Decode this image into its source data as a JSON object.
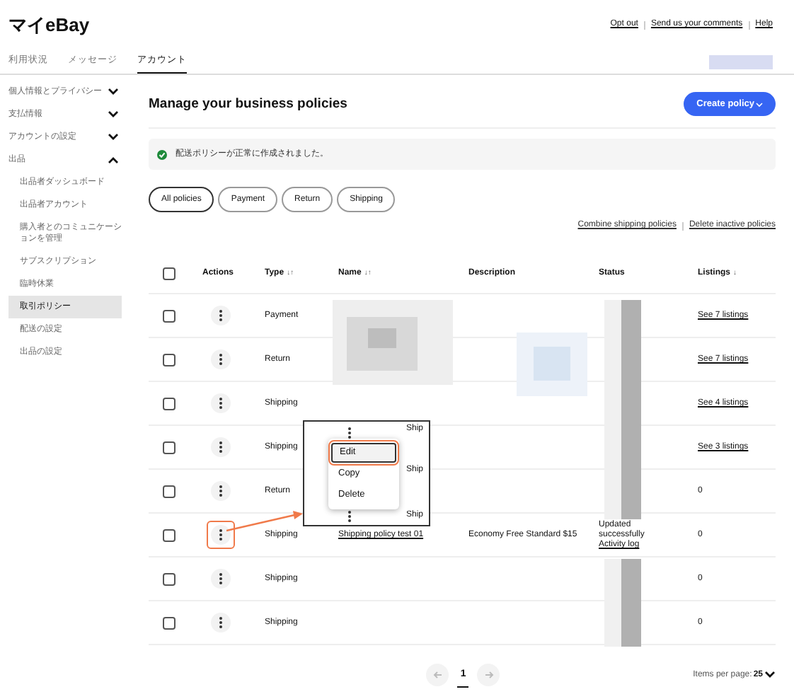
{
  "header": {
    "logo": "マイeBay",
    "links": [
      "Opt out",
      "Send us your comments",
      "Help"
    ]
  },
  "tabs": [
    {
      "label": "利用状況",
      "selected": false
    },
    {
      "label": "メッセージ",
      "selected": false
    },
    {
      "label": "アカウント",
      "selected": true
    }
  ],
  "sidebar": {
    "items": [
      {
        "label": "個人情報とプライバシー",
        "expanded": false
      },
      {
        "label": "支払情報",
        "expanded": false
      },
      {
        "label": "アカウントの設定",
        "expanded": false
      },
      {
        "label": "出品",
        "expanded": true,
        "children": [
          {
            "label": "出品者ダッシュボード",
            "selected": false
          },
          {
            "label": "出品者アカウント",
            "selected": false
          },
          {
            "label": "購入者とのコミュニケーションを管理",
            "selected": false
          },
          {
            "label": "サブスクリプション",
            "selected": false
          },
          {
            "label": "臨時休業",
            "selected": false
          },
          {
            "label": "取引ポリシー",
            "selected": true
          },
          {
            "label": "配送の設定",
            "selected": false
          },
          {
            "label": "出品の設定",
            "selected": false
          }
        ]
      }
    ]
  },
  "main": {
    "title": "Manage your business policies",
    "create_button": "Create policy",
    "banner": "配送ポリシーが正常に作成されました。",
    "filters": [
      {
        "label": "All policies",
        "selected": true
      },
      {
        "label": "Payment",
        "selected": false
      },
      {
        "label": "Return",
        "selected": false
      },
      {
        "label": "Shipping",
        "selected": false
      }
    ],
    "links": [
      "Combine shipping policies",
      "Delete inactive policies"
    ]
  },
  "table": {
    "all_checked": false,
    "columns": [
      {
        "label": "Actions"
      },
      {
        "label": "Type",
        "sort": "↓↑"
      },
      {
        "label": "Name",
        "sort": "↓↑"
      },
      {
        "label": "Description"
      },
      {
        "label": "Status"
      },
      {
        "label": "Listings",
        "sort": "↓"
      }
    ],
    "rows": [
      {
        "checked": false,
        "type": "Payment",
        "listings": "See 7 listings",
        "highlighted": false
      },
      {
        "checked": false,
        "type": "Return",
        "listings": "See 7 listings",
        "highlighted": false
      },
      {
        "checked": false,
        "type": "Shipping",
        "listings": "See 4 listings",
        "highlighted": false
      },
      {
        "checked": false,
        "type": "Shipping",
        "listings": "See 3 listings",
        "highlighted": false
      },
      {
        "checked": false,
        "type": "Return",
        "listings": "0",
        "highlighted": false
      },
      {
        "checked": false,
        "type": "Shipping",
        "name": "Shipping policy test 01",
        "description": "Economy Free Standard $15",
        "status": "Updated successfully",
        "status_link": "Activity log",
        "listings": "0",
        "highlighted": true
      },
      {
        "checked": false,
        "type": "Shipping",
        "listings": "0",
        "highlighted": false
      },
      {
        "checked": false,
        "type": "Shipping",
        "listings": "0",
        "highlighted": false
      }
    ]
  },
  "callout": {
    "fragments": [
      "Ship",
      "Ship",
      "Ship"
    ],
    "menu": [
      {
        "label": "Edit",
        "highlighted": true
      },
      {
        "label": "Copy",
        "highlighted": false
      },
      {
        "label": "Delete",
        "highlighted": false
      }
    ]
  },
  "pagination": {
    "page": "1",
    "items_per_page_label": "Items per page:",
    "items_per_page": "25"
  }
}
